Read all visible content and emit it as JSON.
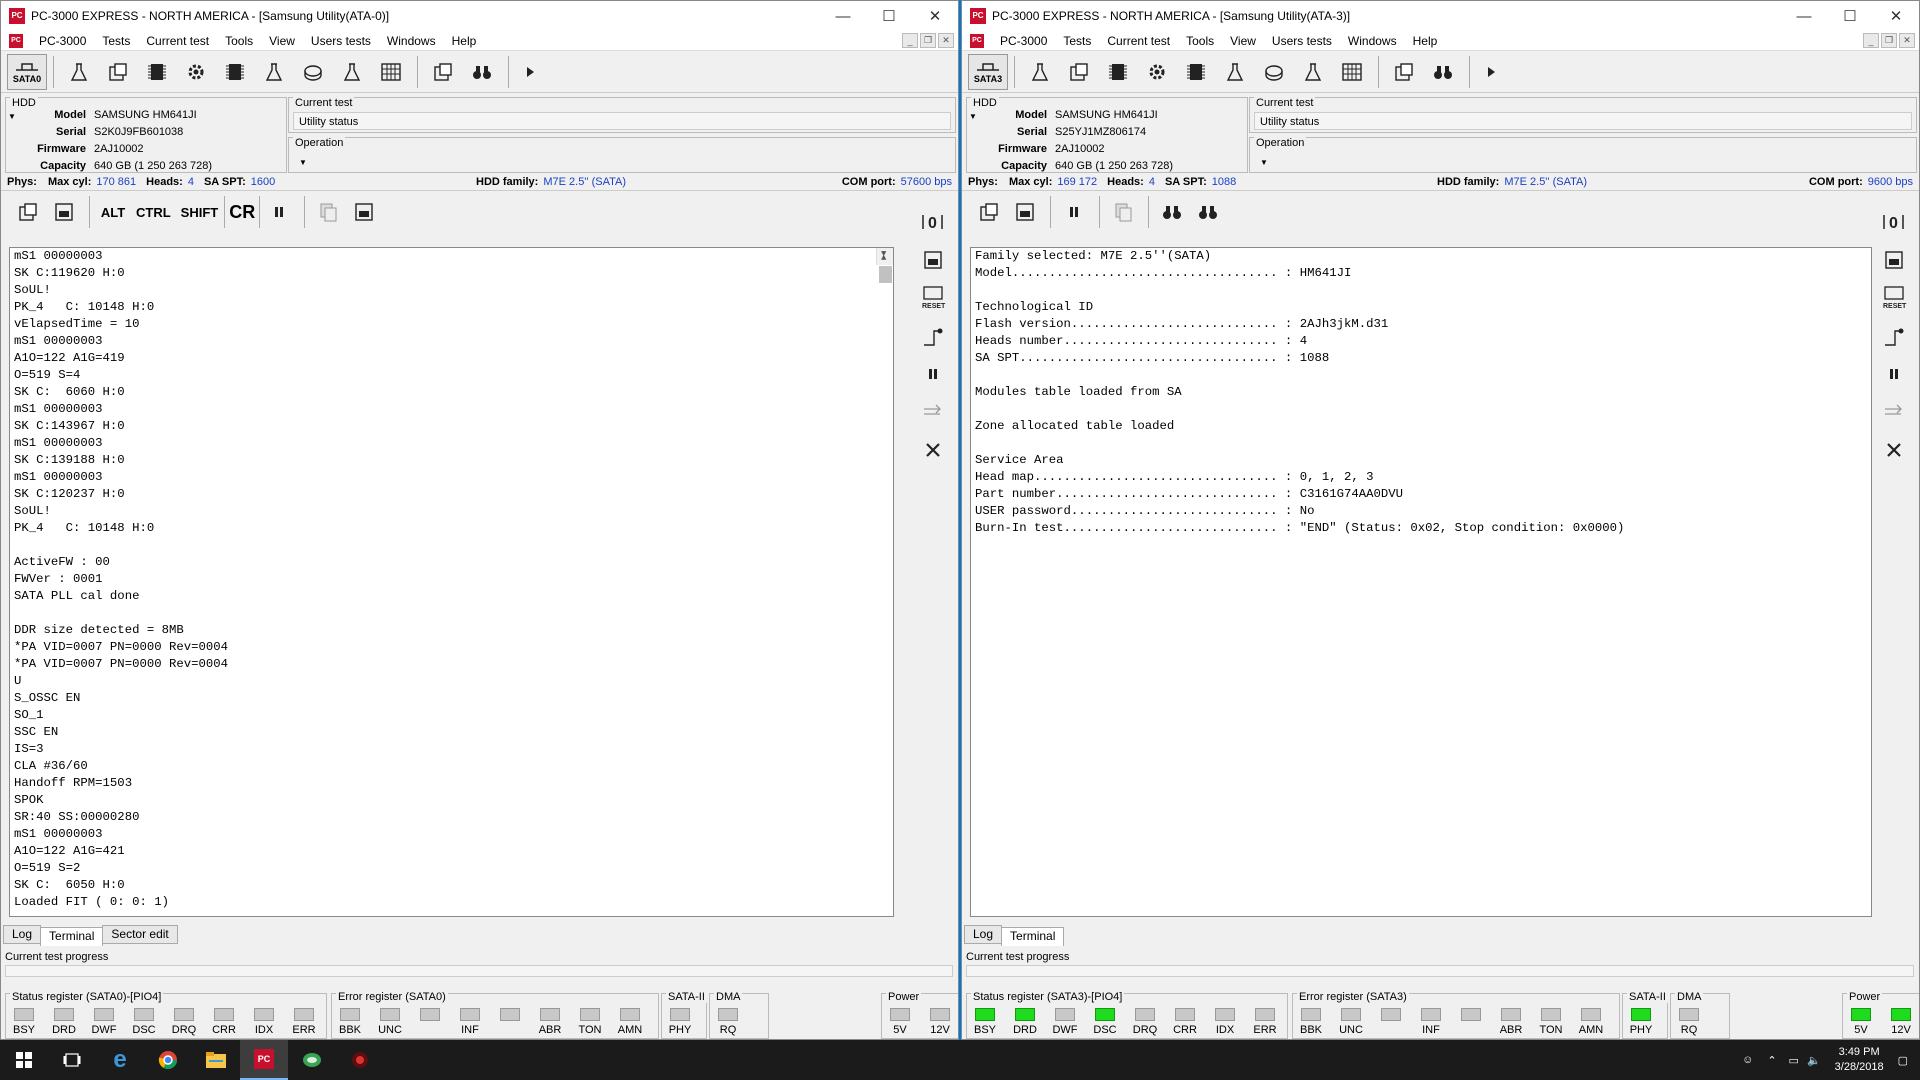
{
  "left": {
    "title": "PC-3000 EXPRESS - NORTH AMERICA - [Samsung Utility(ATA-0)]",
    "menu": [
      "PC-3000",
      "Tests",
      "Current test",
      "Tools",
      "View",
      "Users tests",
      "Windows",
      "Help"
    ],
    "port_label": "SATA0",
    "hdd": {
      "group": "HDD",
      "model": "SAMSUNG HM641JI",
      "serial": "S2K0J9FB601038",
      "firmware": "2AJ10002",
      "capacity": "640 GB (1 250 263 728)"
    },
    "current_test": {
      "label": "Current test",
      "value": "Utility status"
    },
    "operation": {
      "label": "Operation"
    },
    "phys": {
      "phys": "Phys:",
      "maxcyl_l": "Max cyl:",
      "maxcyl": "170 861",
      "heads_l": "Heads:",
      "heads": "4",
      "saspt_l": "SA SPT:",
      "saspt": "1600",
      "family_l": "HDD family:",
      "family": "M7E 2.5'' (SATA)",
      "com_l": "COM port:",
      "com": "57600 bps"
    },
    "terminal": [
      "mS1 00000003",
      "SK C:119620 H:0",
      "SoUL!",
      "PK_4   C: 10148 H:0",
      "vElapsedTime = 10",
      "mS1 00000003",
      "A1O=122 A1G=419",
      "O=519 S=4",
      "SK C:  6060 H:0",
      "mS1 00000003",
      "SK C:143967 H:0",
      "mS1 00000003",
      "SK C:139188 H:0",
      "mS1 00000003",
      "SK C:120237 H:0",
      "SoUL!",
      "PK_4   C: 10148 H:0",
      "",
      "ActiveFW : 00",
      "FWVer : 0001",
      "SATA PLL cal done",
      "",
      "DDR size detected = 8MB",
      "*PA VID=0007 PN=0000 Rev=0004",
      "*PA VID=0007 PN=0000 Rev=0004",
      "U",
      "S_OSSC EN",
      "SO_1",
      "SSC EN",
      "IS=3",
      "CLA #36/60",
      "Handoff RPM=1503",
      "SPOK",
      "SR:40 SS:00000280",
      "mS1 00000003",
      "A1O=122 A1G=421",
      "O=519 S=2",
      "SK C:  6050 H:0",
      "Loaded FIT ( 0: 0: 1)"
    ],
    "tabs": [
      "Log",
      "Terminal",
      "Sector edit"
    ],
    "progress": "Current test progress",
    "regs": {
      "status": "Status register (SATA0)-[PIO4]",
      "error": "Error register (SATA0)",
      "sata2": "SATA-II",
      "dma": "DMA",
      "power": "Power"
    }
  },
  "right": {
    "title": "PC-3000 EXPRESS - NORTH AMERICA - [Samsung Utility(ATA-3)]",
    "menu": [
      "PC-3000",
      "Tests",
      "Current test",
      "Tools",
      "View",
      "Users tests",
      "Windows",
      "Help"
    ],
    "port_label": "SATA3",
    "hdd": {
      "group": "HDD",
      "model": "SAMSUNG HM641JI",
      "serial": "S25YJ1MZ806174",
      "firmware": "2AJ10002",
      "capacity": "640 GB (1 250 263 728)"
    },
    "current_test": {
      "label": "Current test",
      "value": "Utility status"
    },
    "operation": {
      "label": "Operation"
    },
    "phys": {
      "phys": "Phys:",
      "maxcyl_l": "Max cyl:",
      "maxcyl": "169 172",
      "heads_l": "Heads:",
      "heads": "4",
      "saspt_l": "SA SPT:",
      "saspt": "1088",
      "family_l": "HDD family:",
      "family": "M7E 2.5'' (SATA)",
      "com_l": "COM port:",
      "com": "9600 bps"
    },
    "terminal": [
      "Family selected: M7E 2.5''(SATA)",
      "Model.................................... : HM641JI",
      "",
      "Technological ID",
      "Flash version............................ : 2AJh3jkM.d31",
      "Heads number............................. : 4",
      "SA SPT................................... : 1088",
      "",
      "Modules table loaded from SA",
      "",
      "Zone allocated table loaded",
      "",
      "Service Area",
      "Head map................................. : 0, 1, 2, 3",
      "Part number.............................. : C3161G74AA0DVU",
      "USER password............................ : No",
      "Burn-In test............................. : \"END\" (Status: 0x02, Stop condition: 0x0000)"
    ],
    "tabs": [
      "Log",
      "Terminal"
    ],
    "progress": "Current test progress",
    "regs": {
      "status": "Status register (SATA3)-[PIO4]",
      "error": "Error register (SATA3)",
      "sata2": "SATA-II",
      "dma": "DMA",
      "power": "Power"
    }
  },
  "leds": {
    "status": [
      "BSY",
      "DRD",
      "DWF",
      "DSC",
      "DRQ",
      "CRR",
      "IDX",
      "ERR"
    ],
    "error": [
      "BBK",
      "UNC",
      "",
      "INF",
      "",
      "ABR",
      "TON",
      "AMN"
    ],
    "sata2": [
      "PHY"
    ],
    "dma": [
      "RQ"
    ],
    "power": [
      "5V",
      "12V"
    ],
    "right_on": {
      "status": [
        true,
        true,
        false,
        true,
        false,
        false,
        false,
        false
      ],
      "sata2": [
        true
      ],
      "power": [
        true,
        true
      ]
    }
  },
  "hdd_labels": {
    "model": "Model",
    "serial": "Serial",
    "firmware": "Firmware",
    "capacity": "Capacity"
  },
  "toolbar_text": {
    "alt": "ALT",
    "ctrl": "CTRL",
    "shift": "SHIFT",
    "cr": "CR"
  },
  "taskbar": {
    "time": "3:49 PM",
    "date": "3/28/2018"
  }
}
